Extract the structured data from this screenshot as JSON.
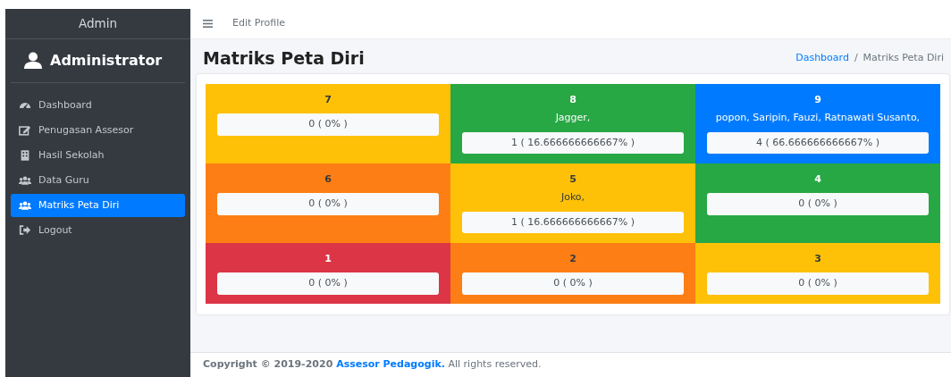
{
  "sidebar": {
    "brand": "Admin",
    "user": "Administrator",
    "items": [
      {
        "label": "Dashboard",
        "selected": false
      },
      {
        "label": "Penugasan Assesor",
        "selected": false
      },
      {
        "label": "Hasil Sekolah",
        "selected": false
      },
      {
        "label": "Data Guru",
        "selected": false
      },
      {
        "label": "Matriks Peta Diri",
        "selected": true
      },
      {
        "label": "Logout",
        "selected": false
      }
    ]
  },
  "topbar": {
    "link": "Edit Profile"
  },
  "page": {
    "title": "Matriks Peta Diri",
    "breadcrumb": [
      {
        "label": "Dashboard",
        "kind": "link"
      },
      {
        "label": "/",
        "kind": "separator"
      },
      {
        "label": "Matriks Peta Diri",
        "kind": "current"
      }
    ]
  },
  "matrix": [
    {
      "number": "7",
      "count": "0 ( 0% )",
      "color": "#ffc107"
    },
    {
      "number": "8",
      "names": "Jagger,",
      "count": "1 ( 16.666666666667% )",
      "color": "#28a745"
    },
    {
      "number": "9",
      "names": "popon, Saripin, Fauzi, Ratnawati Susanto,",
      "count": "4 ( 66.666666666667% )",
      "color": "#007bff"
    },
    {
      "number": "6",
      "count": "0 ( 0% )",
      "color": "#fd7e14"
    },
    {
      "number": "5",
      "names": "Joko,",
      "count": "1 ( 16.666666666667% )",
      "color": "#ffc107"
    },
    {
      "number": "4",
      "count": "0 ( 0% )",
      "color": "#28a745"
    },
    {
      "number": "1",
      "count": "0 ( 0% )",
      "color": "#dc3545"
    },
    {
      "number": "2",
      "count": "0 ( 0% )",
      "color": "#fd7e14"
    },
    {
      "number": "3",
      "count": "0 ( 0% )",
      "color": "#ffc107"
    }
  ],
  "footer": {
    "prefix": "Copyright © 2019-2020",
    "link": "Assesor Pedagogik.",
    "suffix": "All rights reserved."
  }
}
